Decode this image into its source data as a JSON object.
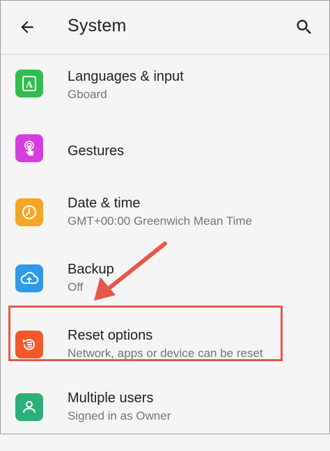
{
  "header": {
    "title": "System",
    "back_icon": "arrow-back-icon",
    "search_icon": "search-icon"
  },
  "items": [
    {
      "title": "Languages & input",
      "subtitle": "Gboard",
      "icon": "language-icon",
      "color": "#2fbf4f"
    },
    {
      "title": "Gestures",
      "subtitle": "",
      "icon": "gesture-icon",
      "color": "#d63de0"
    },
    {
      "title": "Date & time",
      "subtitle": "GMT+00:00 Greenwich Mean Time",
      "icon": "clock-icon",
      "color": "#f5a623"
    },
    {
      "title": "Backup",
      "subtitle": "Off",
      "icon": "cloud-backup-icon",
      "color": "#2f9ae8"
    },
    {
      "title": "Reset options",
      "subtitle": "Network, apps or device can be reset",
      "icon": "reset-icon",
      "color": "#f2582b"
    },
    {
      "title": "Multiple users",
      "subtitle": "Signed in as Owner",
      "icon": "users-icon",
      "color": "#2bb07a"
    }
  ],
  "annotation": {
    "highlight_color": "#e5574a",
    "arrow_color": "#e5574a"
  }
}
